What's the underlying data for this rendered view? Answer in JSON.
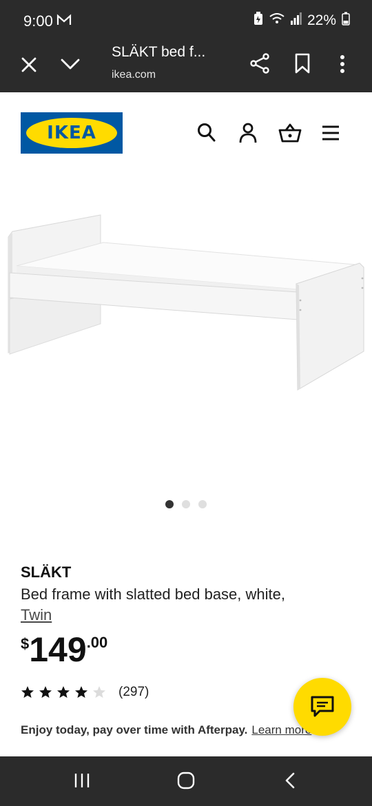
{
  "status_bar": {
    "time": "9:00",
    "battery": "22%",
    "icons": [
      "mail-icon",
      "battery-saver-icon",
      "wifi-icon",
      "signal-icon",
      "battery-icon"
    ]
  },
  "browser": {
    "page_title": "SLÄKT bed f...",
    "url": "ikea.com",
    "icons": [
      "close-icon",
      "chevron-down-icon",
      "share-icon",
      "bookmark-icon",
      "more-icon"
    ]
  },
  "header": {
    "logo_text": "IKEA",
    "logo_colors": {
      "blue": "#0058a3",
      "yellow": "#ffdb00"
    },
    "icons": [
      "search-icon",
      "account-icon",
      "cart-icon",
      "menu-icon"
    ]
  },
  "gallery": {
    "image": "bed-frame",
    "total_images": 3,
    "active_index": 0
  },
  "product": {
    "name": "SLÄKT",
    "description": "Bed frame with slatted bed base, white,",
    "size": "Twin",
    "price_currency": "$",
    "price_integer": "149",
    "price_decimal": ".00",
    "rating": 4,
    "rating_max": 5,
    "reviews": "(297)"
  },
  "afterpay": {
    "text": "Enjoy today, pay over time with Afterpay.",
    "link": "Learn more"
  },
  "chat": {
    "icon": "chat-icon",
    "color": "#ffdb00"
  },
  "nav": {
    "icons": [
      "recent-apps-icon",
      "home-icon",
      "back-icon"
    ]
  }
}
